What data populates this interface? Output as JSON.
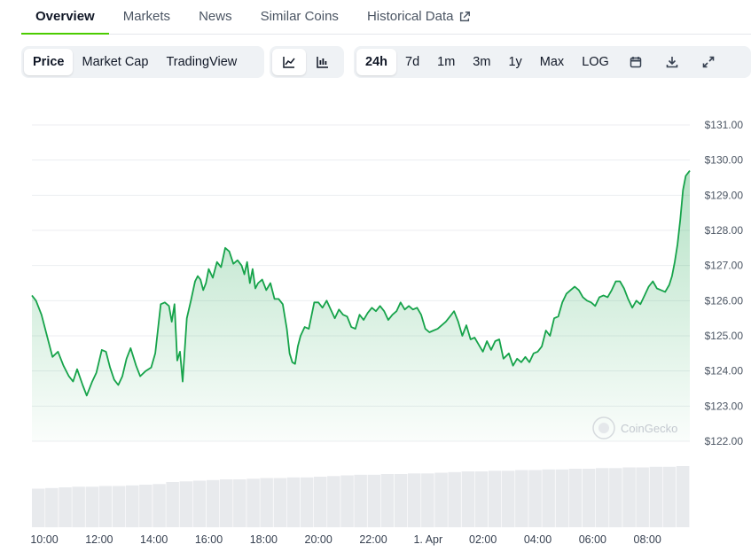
{
  "tabs": [
    {
      "label": "Overview",
      "active": true
    },
    {
      "label": "Markets",
      "active": false
    },
    {
      "label": "News",
      "active": false
    },
    {
      "label": "Similar Coins",
      "active": false
    },
    {
      "label": "Historical Data",
      "active": false,
      "icon": "external-link-icon"
    }
  ],
  "toolbar": {
    "chart_types": [
      {
        "label": "Price",
        "active": true
      },
      {
        "label": "Market Cap",
        "active": false
      },
      {
        "label": "TradingView",
        "active": false
      }
    ],
    "view_icons": [
      {
        "icon": "line-chart-icon",
        "active": true
      },
      {
        "icon": "candlestick-chart-icon",
        "active": false
      }
    ],
    "ranges": [
      {
        "label": "24h",
        "active": true
      },
      {
        "label": "7d",
        "active": false
      },
      {
        "label": "1m",
        "active": false
      },
      {
        "label": "3m",
        "active": false
      },
      {
        "label": "1y",
        "active": false
      },
      {
        "label": "Max",
        "active": false
      },
      {
        "label": "LOG",
        "active": false
      }
    ],
    "action_icons": [
      "calendar-icon",
      "download-icon",
      "fullscreen-icon"
    ]
  },
  "watermark": "CoinGecko",
  "chart_data": {
    "type": "area",
    "line_color": "#16a34a",
    "y_ticks": [
      "$131.00",
      "$130.00",
      "$129.00",
      "$128.00",
      "$127.00",
      "$126.00",
      "$125.00",
      "$124.00",
      "$123.00",
      "$122.00"
    ],
    "ylim": [
      122,
      131
    ],
    "y_axis_position": "right",
    "grid": true,
    "x_ticks": [
      "10:00",
      "12:00",
      "14:00",
      "16:00",
      "18:00",
      "20:00",
      "22:00",
      "1. Apr",
      "02:00",
      "04:00",
      "06:00",
      "08:00"
    ],
    "xlim": [
      0,
      24
    ],
    "series": [
      {
        "x": [
          0,
          0.15,
          0.35,
          0.55,
          0.75,
          0.95,
          1.15,
          1.35,
          1.5,
          1.65,
          1.85,
          2.0,
          2.2,
          2.35,
          2.55,
          2.7,
          2.85,
          3.0,
          3.15,
          3.3,
          3.45,
          3.6,
          3.8,
          3.95,
          4.15,
          4.35,
          4.5,
          4.7,
          4.85,
          5.0,
          5.1,
          5.2,
          5.3,
          5.4,
          5.5,
          5.65,
          5.8,
          5.95,
          6.05,
          6.15,
          6.25,
          6.35,
          6.45,
          6.6,
          6.75,
          6.9,
          7.05,
          7.2,
          7.35,
          7.5,
          7.65,
          7.75,
          7.85,
          7.95,
          8.05,
          8.15,
          8.25,
          8.4,
          8.55,
          8.7,
          8.85,
          9.0,
          9.15,
          9.3,
          9.4,
          9.5,
          9.6,
          9.7,
          9.8,
          9.95,
          10.1,
          10.3,
          10.45,
          10.6,
          10.75,
          10.9,
          11.05,
          11.2,
          11.35,
          11.5,
          11.65,
          11.8,
          11.95,
          12.1,
          12.25,
          12.4,
          12.55,
          12.7,
          12.85,
          13.0,
          13.15,
          13.3,
          13.45,
          13.6,
          13.75,
          13.9,
          14.05,
          14.2,
          14.35,
          14.5,
          14.65,
          14.8,
          14.95,
          15.1,
          15.25,
          15.4,
          15.55,
          15.7,
          15.85,
          16.0,
          16.15,
          16.3,
          16.45,
          16.6,
          16.75,
          16.9,
          17.05,
          17.2,
          17.4,
          17.55,
          17.7,
          17.85,
          18.0,
          18.15,
          18.3,
          18.45,
          18.6,
          18.75,
          18.9,
          19.05,
          19.2,
          19.35,
          19.5,
          19.65,
          19.8,
          19.95,
          20.1,
          20.25,
          20.4,
          20.55,
          20.7,
          20.85,
          21.0,
          21.15,
          21.3,
          21.45,
          21.6,
          21.75,
          21.9,
          22.05,
          22.2,
          22.35,
          22.5,
          22.65,
          22.8,
          22.95,
          23.1,
          23.25,
          23.35,
          23.45,
          23.55,
          23.65,
          23.75,
          23.85,
          24.0
        ],
        "y": [
          126.15,
          126.0,
          125.6,
          125.0,
          124.4,
          124.55,
          124.15,
          123.85,
          123.7,
          124.05,
          123.6,
          123.3,
          123.7,
          123.95,
          124.6,
          124.55,
          124.1,
          123.75,
          123.6,
          123.85,
          124.35,
          124.65,
          124.15,
          123.85,
          124.0,
          124.1,
          124.5,
          125.9,
          125.95,
          125.85,
          125.4,
          125.9,
          124.3,
          124.55,
          123.7,
          125.5,
          126.0,
          126.55,
          126.7,
          126.6,
          126.3,
          126.5,
          126.9,
          126.65,
          127.1,
          126.95,
          127.5,
          127.4,
          127.05,
          127.15,
          127.0,
          126.75,
          127.1,
          126.5,
          126.9,
          126.35,
          126.5,
          126.6,
          126.3,
          126.5,
          126.05,
          126.05,
          125.9,
          125.2,
          124.5,
          124.25,
          124.2,
          124.7,
          125.0,
          125.25,
          125.2,
          125.95,
          125.95,
          125.8,
          126.0,
          125.75,
          125.5,
          125.75,
          125.6,
          125.55,
          125.25,
          125.2,
          125.6,
          125.45,
          125.65,
          125.8,
          125.7,
          125.85,
          125.7,
          125.45,
          125.6,
          125.7,
          125.95,
          125.75,
          125.85,
          125.75,
          125.8,
          125.6,
          125.2,
          125.1,
          125.15,
          125.2,
          125.3,
          125.4,
          125.55,
          125.7,
          125.4,
          125.0,
          125.3,
          124.9,
          124.95,
          124.75,
          124.55,
          124.85,
          124.6,
          124.85,
          124.9,
          124.35,
          124.5,
          124.15,
          124.35,
          124.25,
          124.4,
          124.25,
          124.5,
          124.55,
          124.7,
          125.15,
          125.0,
          125.5,
          125.55,
          125.95,
          126.2,
          126.3,
          126.4,
          126.3,
          126.1,
          126.0,
          125.95,
          125.85,
          126.1,
          126.15,
          126.1,
          126.3,
          126.55,
          126.55,
          126.35,
          126.05,
          125.8,
          126.0,
          125.9,
          126.15,
          126.4,
          126.55,
          126.35,
          126.3,
          126.25,
          126.45,
          126.7,
          127.1,
          127.6,
          128.3,
          129.15,
          129.55,
          129.7
        ]
      }
    ],
    "volume": {
      "min": 0,
      "max": 1.0,
      "values": [
        0.58,
        0.59,
        0.6,
        0.61,
        0.61,
        0.62,
        0.62,
        0.63,
        0.64,
        0.65,
        0.68,
        0.69,
        0.7,
        0.71,
        0.72,
        0.72,
        0.73,
        0.74,
        0.74,
        0.75,
        0.75,
        0.76,
        0.77,
        0.78,
        0.79,
        0.79,
        0.8,
        0.8,
        0.81,
        0.81,
        0.82,
        0.83,
        0.84,
        0.84,
        0.85,
        0.85,
        0.86,
        0.86,
        0.87,
        0.87,
        0.88,
        0.88,
        0.89,
        0.89,
        0.9,
        0.9,
        0.91,
        0.91,
        0.92
      ]
    }
  }
}
